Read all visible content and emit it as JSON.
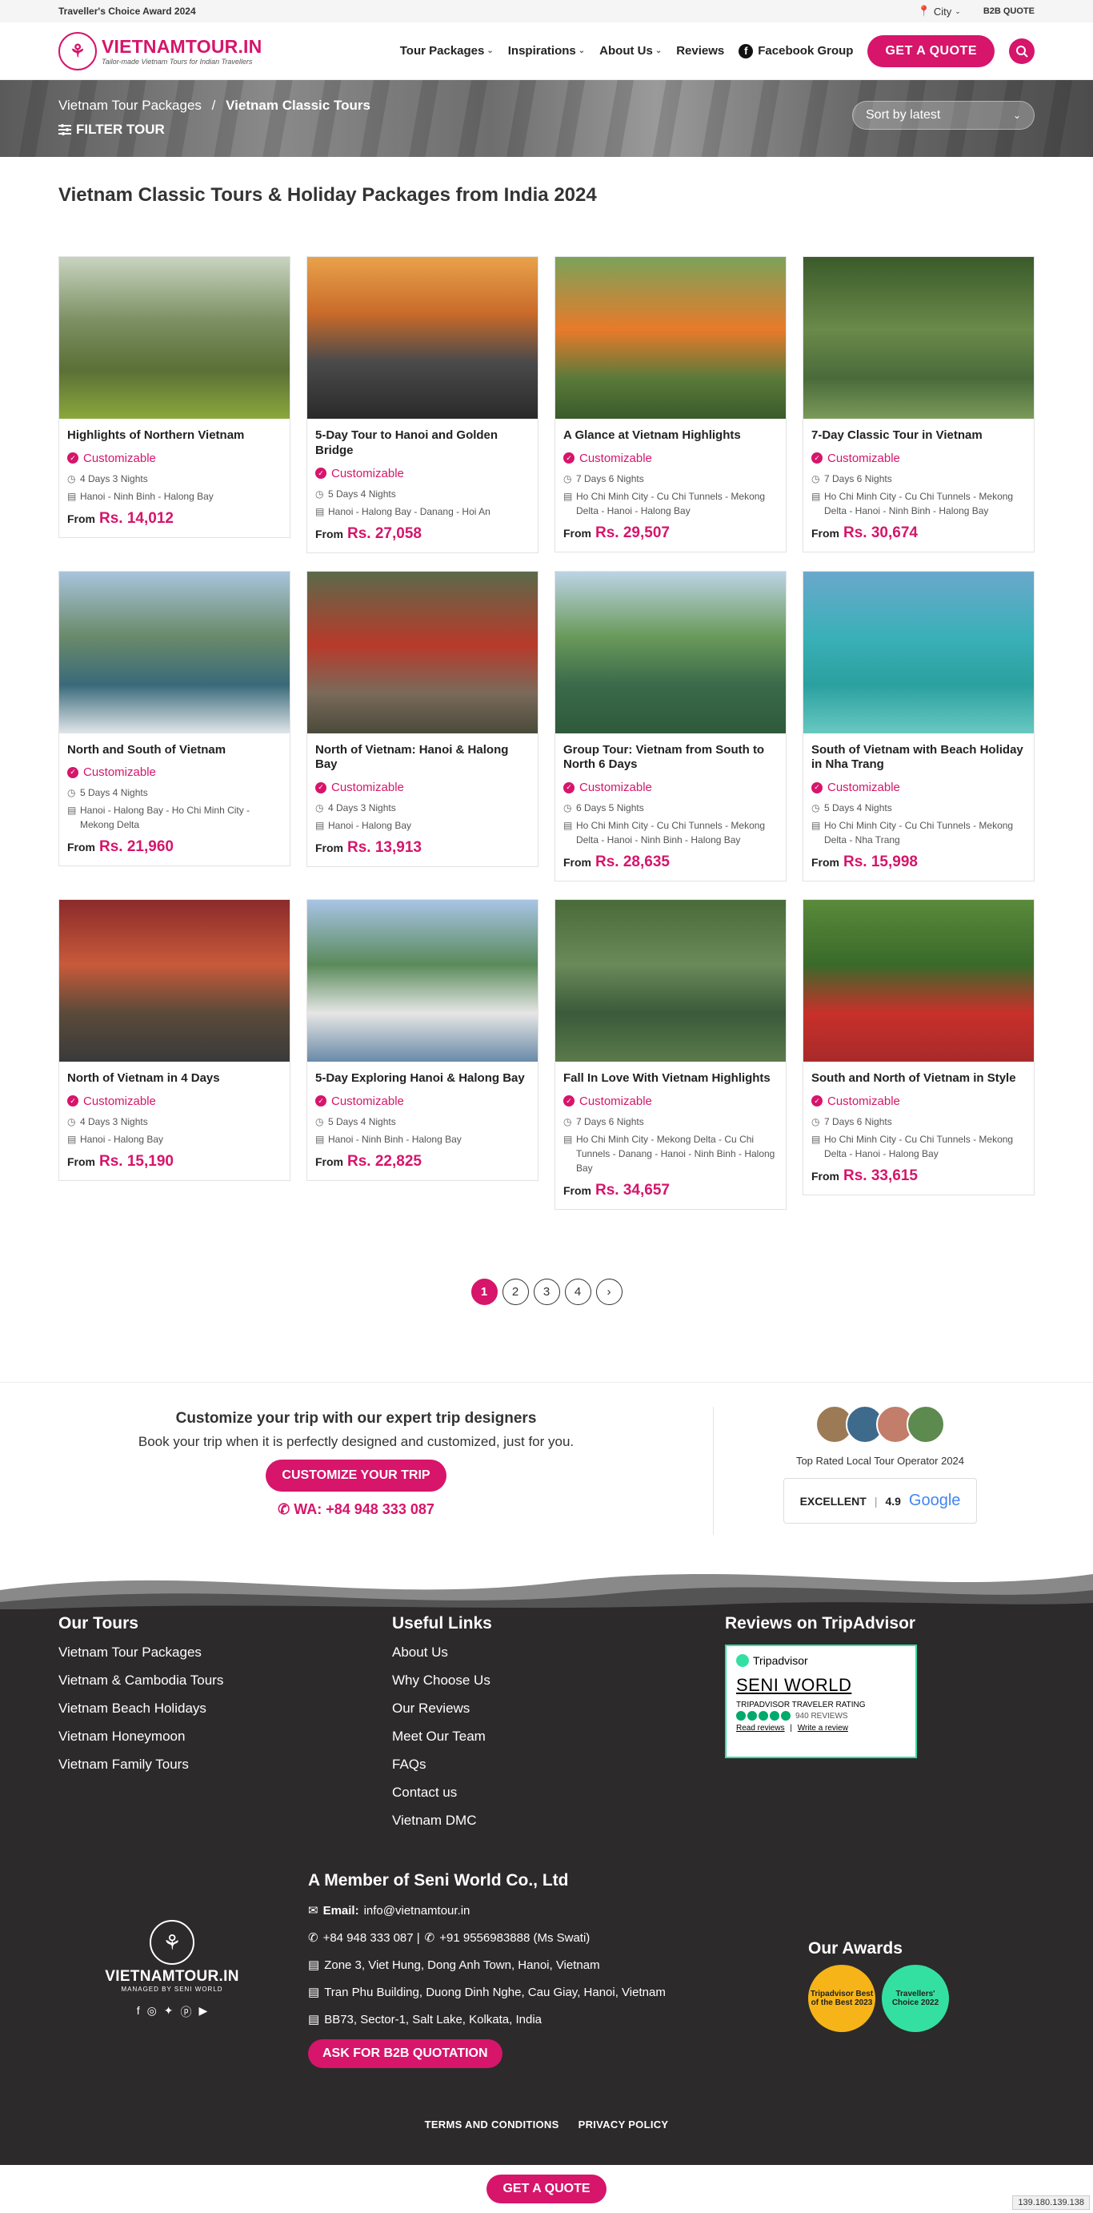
{
  "topbar": {
    "award": "Traveller's Choice Award 2024",
    "city": "City",
    "b2b": "B2B QUOTE"
  },
  "header": {
    "logo_name": "VIETNAMTOUR.IN",
    "logo_tag": "Tailor-made Vietnam Tours for Indian Travellers",
    "nav": [
      "Tour Packages",
      "Inspirations",
      "About Us",
      "Reviews",
      "Facebook Group"
    ],
    "quote_label": "GET A QUOTE"
  },
  "banner": {
    "crumb_parent": "Vietnam Tour Packages",
    "crumb_sep": "/",
    "crumb_current": "Vietnam Classic Tours",
    "filter_label": "FILTER TOUR",
    "sort_label": "Sort by latest"
  },
  "page_title": "Vietnam Classic Tours & Holiday Packages from India 2024",
  "tours": [
    {
      "name": "Highlights of Northern Vietnam",
      "custom": "Customizable",
      "duration": "4 Days 3 Nights",
      "route": "Hanoi - Ninh Binh - Halong Bay",
      "from": "From",
      "price": "Rs. 14,012"
    },
    {
      "name": "5-Day Tour to Hanoi and Golden Bridge",
      "custom": "Customizable",
      "duration": "5 Days 4 Nights",
      "route": "Hanoi - Halong Bay - Danang - Hoi An",
      "from": "From",
      "price": "Rs. 27,058"
    },
    {
      "name": "A Glance at Vietnam Highlights",
      "custom": "Customizable",
      "duration": "7 Days 6 Nights",
      "route": "Ho Chi Minh City - Cu Chi Tunnels - Mekong Delta - Hanoi - Halong Bay",
      "from": "From",
      "price": "Rs. 29,507"
    },
    {
      "name": "7-Day Classic Tour in Vietnam",
      "custom": "Customizable",
      "duration": "7 Days 6 Nights",
      "route": "Ho Chi Minh City - Cu Chi Tunnels - Mekong Delta - Hanoi - Ninh Binh - Halong Bay",
      "from": "From",
      "price": "Rs. 30,674"
    },
    {
      "name": "North and South of Vietnam",
      "custom": "Customizable",
      "duration": "5 Days 4 Nights",
      "route": "Hanoi - Halong Bay - Ho Chi Minh City - Mekong Delta",
      "from": "From",
      "price": "Rs. 21,960"
    },
    {
      "name": "North of Vietnam: Hanoi & Halong Bay",
      "custom": "Customizable",
      "duration": "4 Days 3 Nights",
      "route": "Hanoi - Halong Bay",
      "from": "From",
      "price": "Rs. 13,913"
    },
    {
      "name": "Group Tour: Vietnam from South to North 6 Days",
      "custom": "Customizable",
      "duration": "6 Days 5 Nights",
      "route": "Ho Chi Minh City - Cu Chi Tunnels - Mekong Delta - Hanoi - Ninh Binh - Halong Bay",
      "from": "From",
      "price": "Rs. 28,635"
    },
    {
      "name": "South of Vietnam with Beach Holiday in Nha Trang",
      "custom": "Customizable",
      "duration": "5 Days 4 Nights",
      "route": "Ho Chi Minh City - Cu Chi Tunnels - Mekong Delta - Nha Trang",
      "from": "From",
      "price": "Rs. 15,998"
    },
    {
      "name": "North of Vietnam in 4 Days",
      "custom": "Customizable",
      "duration": "4 Days 3 Nights",
      "route": "Hanoi - Halong Bay",
      "from": "From",
      "price": "Rs. 15,190"
    },
    {
      "name": "5-Day Exploring Hanoi & Halong Bay",
      "custom": "Customizable",
      "duration": "5 Days 4 Nights",
      "route": "Hanoi - Ninh Binh - Halong Bay",
      "from": "From",
      "price": "Rs. 22,825"
    },
    {
      "name": "Fall In Love With Vietnam Highlights",
      "custom": "Customizable",
      "duration": "7 Days 6 Nights",
      "route": "Ho Chi Minh City - Mekong Delta - Cu Chi Tunnels - Danang - Hanoi - Ninh Binh - Halong Bay",
      "from": "From",
      "price": "Rs. 34,657"
    },
    {
      "name": "South and North of Vietnam in Style",
      "custom": "Customizable",
      "duration": "7 Days 6 Nights",
      "route": "Ho Chi Minh City - Cu Chi Tunnels - Mekong Delta - Hanoi - Halong Bay",
      "from": "From",
      "price": "Rs. 33,615"
    }
  ],
  "pagination": {
    "pages": [
      "1",
      "2",
      "3",
      "4"
    ],
    "current": "1",
    "next": "›"
  },
  "cta": {
    "heading": "Customize your trip with our expert trip designers",
    "sub": "Book your trip when it is perfectly designed and customized, just for you.",
    "button": "CUSTOMIZE YOUR TRIP",
    "wa": "WA: +84 948 333 087",
    "rated": "Top Rated Local Tour Operator 2024",
    "excellent": "EXCELLENT",
    "score": "4.9",
    "google": "Google"
  },
  "footer": {
    "tours_title": "Our Tours",
    "tours": [
      "Vietnam Tour Packages",
      "Vietnam & Cambodia Tours",
      "Vietnam Beach Holidays",
      "Vietnam Honeymoon",
      "Vietnam Family Tours"
    ],
    "links_title": "Useful Links",
    "links": [
      "About Us",
      "Why Choose Us",
      "Our Reviews",
      "Meet Our Team",
      "FAQs",
      "Contact us",
      "Vietnam DMC"
    ],
    "reviews_title": "Reviews on TripAdvisor",
    "ta": {
      "brand": "Tripadvisor",
      "name": "SENI WORLD",
      "rating_label": "TRIPADVISOR TRAVELER RATING",
      "reviews": "940 REVIEWS",
      "read": "Read reviews",
      "write": "Write a review",
      "sep": "|"
    },
    "member_title": "A Member of Seni World Co., Ltd",
    "email_label": "Email:",
    "email": "info@vietnamtour.in",
    "phones": "+84 948 333 087 | ",
    "phone2": "+91 9556983888 (Ms Swati)",
    "addr1": "Zone 3, Viet Hung, Dong Anh Town, Hanoi, Vietnam",
    "addr2": "Tran Phu Building, Duong Dinh Nghe, Cau Giay, Hanoi, Vietnam",
    "addr3": "BB73, Sector-1, Salt Lake, Kolkata, India",
    "b2b_button": "ASK FOR B2B QUOTATION",
    "logo_name": "VIETNAMTOUR.IN",
    "logo_sub": "MANAGED BY SENI WORLD",
    "awards_title": "Our Awards",
    "award1": "Tripadvisor Best of the Best 2023",
    "award2": "Travellers' Choice 2022",
    "terms": "TERMS AND CONDITIONS",
    "privacy": "PRIVACY POLICY"
  },
  "bottom": {
    "quote": "GET A QUOTE",
    "ip": "139.180.139.138"
  },
  "colors": {
    "accent": "#d6156b",
    "footer_bg": "#2c2a2b"
  }
}
